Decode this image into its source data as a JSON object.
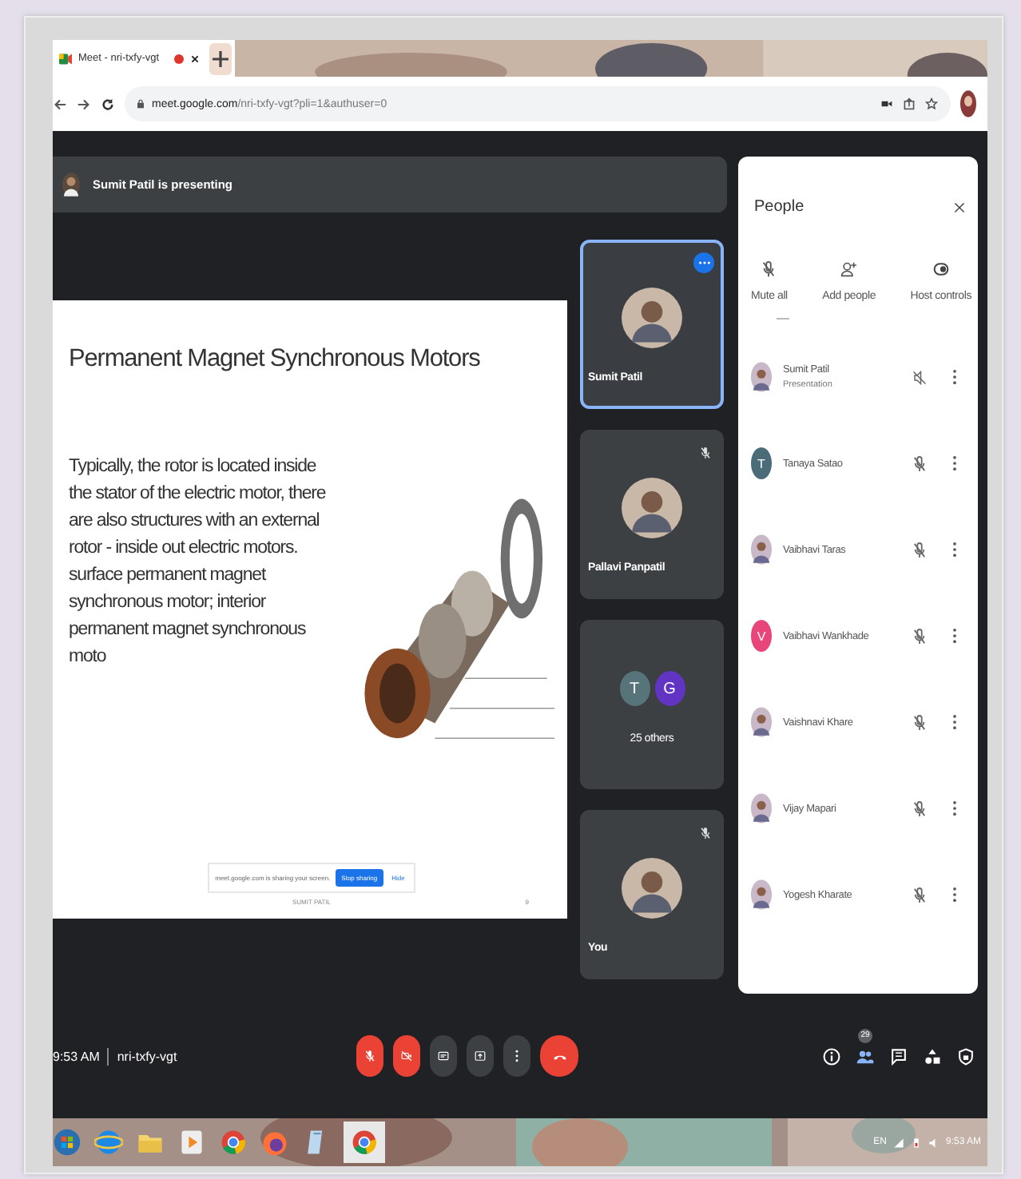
{
  "browser": {
    "tab": {
      "title": "Meet - nri-txfy-vgt",
      "recording": true
    },
    "address": {
      "host": "meet.google.com",
      "path": "/nri-txfy-vgt?pli=1&authuser=0"
    }
  },
  "meet": {
    "banner": "Sumit Patil is presenting",
    "slide": {
      "title": "Permanent Magnet Synchronous Motors",
      "bullet": "Typically, the rotor is located inside the stator of the electric motor, there are also structures with an external rotor - inside out electric motors. surface permanent magnet synchronous motor; interior permanent magnet synchronous moto",
      "share_bar": {
        "message": "meet.google.com is sharing your screen.",
        "stop": "Stop sharing",
        "hide": "Hide"
      },
      "footer": {
        "author": "SUMIT PATIL",
        "page": "9"
      }
    },
    "tiles": [
      {
        "name": "Sumit Patil",
        "speaking": true,
        "muted": false
      },
      {
        "name": "Pallavi Panpatil",
        "speaking": false,
        "muted": true
      },
      {
        "name": "25 others",
        "kind": "group",
        "speaking": false,
        "muted": false,
        "letters": [
          {
            "letter": "T",
            "color": "#56747a"
          },
          {
            "letter": "G",
            "color": "#6234c4"
          }
        ]
      },
      {
        "name": "You",
        "speaking": false,
        "muted": true
      }
    ],
    "people": {
      "title": "People",
      "actions": [
        "Mute all",
        "Add people",
        "Host controls"
      ],
      "list": [
        {
          "name": "Sumit Patil",
          "subtitle": "Presentation",
          "kind": "presentation"
        },
        {
          "name": "Tanaya Satao",
          "letter": "T",
          "color": "#4a6b78",
          "kind": "participant"
        },
        {
          "name": "Vaibhavi Taras",
          "kind": "participant"
        },
        {
          "name": "Vaibhavi Wankhade",
          "letter": "V",
          "color": "#e8457a",
          "kind": "participant"
        },
        {
          "name": "Vaishnavi Khare",
          "kind": "participant"
        },
        {
          "name": "Vijay Mapari",
          "kind": "participant"
        },
        {
          "name": "Yogesh Kharate",
          "kind": "participant"
        }
      ]
    },
    "bottom": {
      "time": "9:53 AM",
      "code": "nri-txfy-vgt",
      "controls": [
        {
          "kind": "mic",
          "on": false
        },
        {
          "kind": "camera",
          "on": false
        },
        {
          "kind": "captions",
          "on": false
        },
        {
          "kind": "present",
          "on": false
        },
        {
          "kind": "more",
          "on": false
        },
        {
          "kind": "leave"
        }
      ],
      "people_count": "29"
    }
  },
  "taskbar": {
    "language": "EN",
    "clock": "9:53 AM"
  }
}
